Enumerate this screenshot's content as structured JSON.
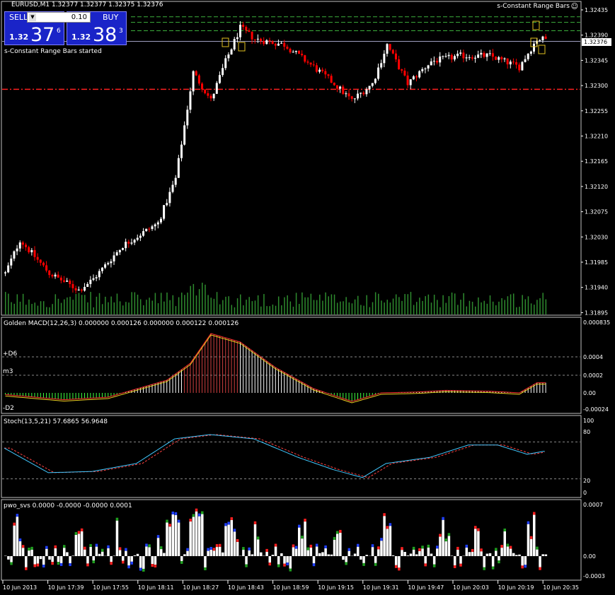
{
  "header": {
    "symbol_line": "EURUSD,M1  1.32377 1.32377 1.32375 1.32376",
    "ea_name": "s-Constant Range Bars",
    "ea_icon": "smiley-icon",
    "started_msg": "s-Constant Range Bars started"
  },
  "trade_panel": {
    "sell_label": "SELL",
    "buy_label": "BUY",
    "lot_value": "0.10",
    "sell_small": "1.32",
    "sell_big": "37",
    "sell_sup": "6",
    "buy_small": "1.32",
    "buy_big": "38",
    "buy_sup": "3"
  },
  "price_axis": {
    "ticks": [
      "1.32435",
      "1.32390",
      "1.32345",
      "1.32300",
      "1.32255",
      "1.32210",
      "1.32165",
      "1.32120",
      "1.32075",
      "1.32030",
      "1.31985",
      "1.31940",
      "1.31895"
    ],
    "current_price": "1.32376",
    "min": 1.31885,
    "max": 1.32445
  },
  "time_axis": {
    "ticks": [
      "10 Jun 2013",
      "10 Jun 17:39",
      "10 Jun 17:55",
      "10 Jun 18:11",
      "10 Jun 18:27",
      "10 Jun 18:43",
      "10 Jun 18:59",
      "10 Jun 19:15",
      "10 Jun 19:31",
      "10 Jun 19:47",
      "10 Jun 20:03",
      "10 Jun 20:19",
      "10 Jun 20:35"
    ]
  },
  "macd": {
    "title": "Golden MACD(12,26,3) 0.000000 0.000126 0.000000 0.000122 0.000126",
    "level_labels": [
      "+D6",
      "m3",
      "-D2"
    ],
    "axis_ticks": [
      "0.000835",
      "0.0004",
      "0.0002",
      "0.00",
      "-0.00024"
    ]
  },
  "stoch": {
    "title": "Stoch(13,5,21) 57.6865 56.9648",
    "axis_ticks": [
      "100",
      "80",
      "20",
      "0"
    ]
  },
  "pwo": {
    "title": "pwo_svs 0.0000 -0.0000 -0.0000 0.0001",
    "axis_ticks": [
      "0.0007",
      "0.00",
      "-0.0003"
    ]
  },
  "colors": {
    "bull": "#ffffff",
    "bear": "#ff0000",
    "volume": "#2e8b2e",
    "support_line": "#ff2020",
    "resistance_lines": "#3cb03c",
    "price_line": "#a0a0c0",
    "stoch_main": "#40c8ff",
    "stoch_signal": "#ff4040",
    "trade_button": "#1a24c8"
  },
  "chart_data": {
    "type": "candlestick",
    "symbol": "EURUSD",
    "timeframe": "M1",
    "price_start": 1.3196,
    "price_end": 1.32376,
    "support_level": 1.3229,
    "resistance_levels": [
      1.3242,
      1.3241,
      1.32395
    ]
  }
}
